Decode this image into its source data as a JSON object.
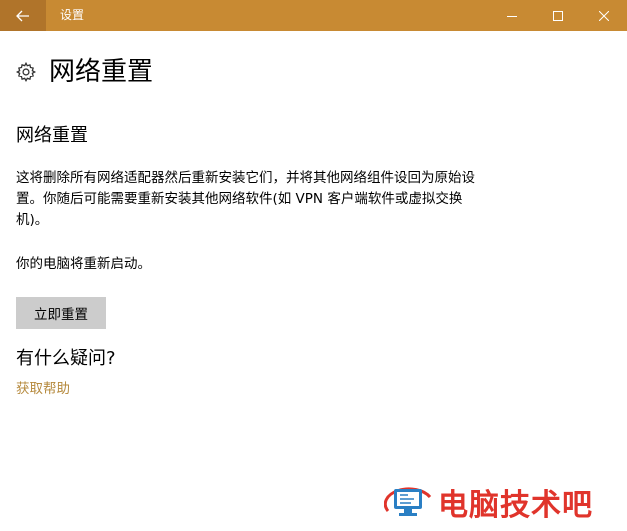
{
  "window": {
    "title": "设置"
  },
  "page": {
    "title": "网络重置"
  },
  "section": {
    "title": "网络重置",
    "description": "这将删除所有网络适配器然后重新安装它们，并将其他网络组件设回为原始设置。你随后可能需要重新安装其他网络软件(如 VPN 客户端软件或虚拟交换机)。",
    "restart_note": "你的电脑将重新启动。",
    "reset_button_label": "立即重置"
  },
  "faq": {
    "title": "有什么疑问?",
    "help_link": "获取帮助"
  },
  "watermark": {
    "text": "电脑技术吧"
  },
  "colors": {
    "titlebar": "#c88a33",
    "accent_link": "#b68a3e",
    "button_bg": "#cccccc",
    "watermark": "#e0342b"
  }
}
